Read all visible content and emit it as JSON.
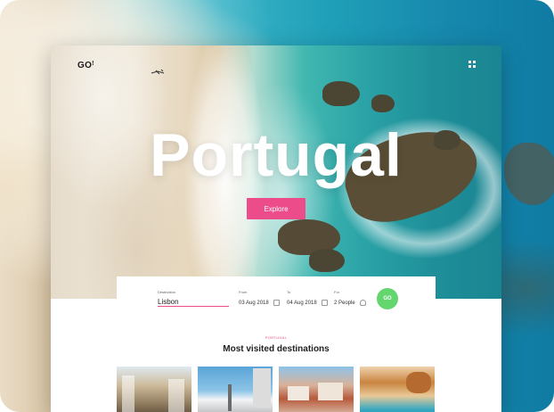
{
  "brand": {
    "logo": "GO",
    "logo_mark": "!"
  },
  "hero": {
    "title": "Portugal",
    "explore_label": "Explore"
  },
  "search": {
    "destination": {
      "label": "Destination",
      "value": "Lisbon"
    },
    "from": {
      "label": "From",
      "value": "03 Aug 2018"
    },
    "to": {
      "label": "To",
      "value": "04 Aug 2018"
    },
    "for": {
      "label": "For",
      "value": "2 People"
    },
    "go_label": "GO"
  },
  "section": {
    "kicker": "PORTUGAL",
    "title": "Most visited destinations"
  },
  "destinations": [
    {
      "icon": "street-photo"
    },
    {
      "icon": "monument-photo"
    },
    {
      "icon": "rooftops-photo"
    },
    {
      "icon": "beach-photo"
    }
  ],
  "colors": {
    "accent": "#ec4c8a",
    "go": "#64d66e"
  }
}
